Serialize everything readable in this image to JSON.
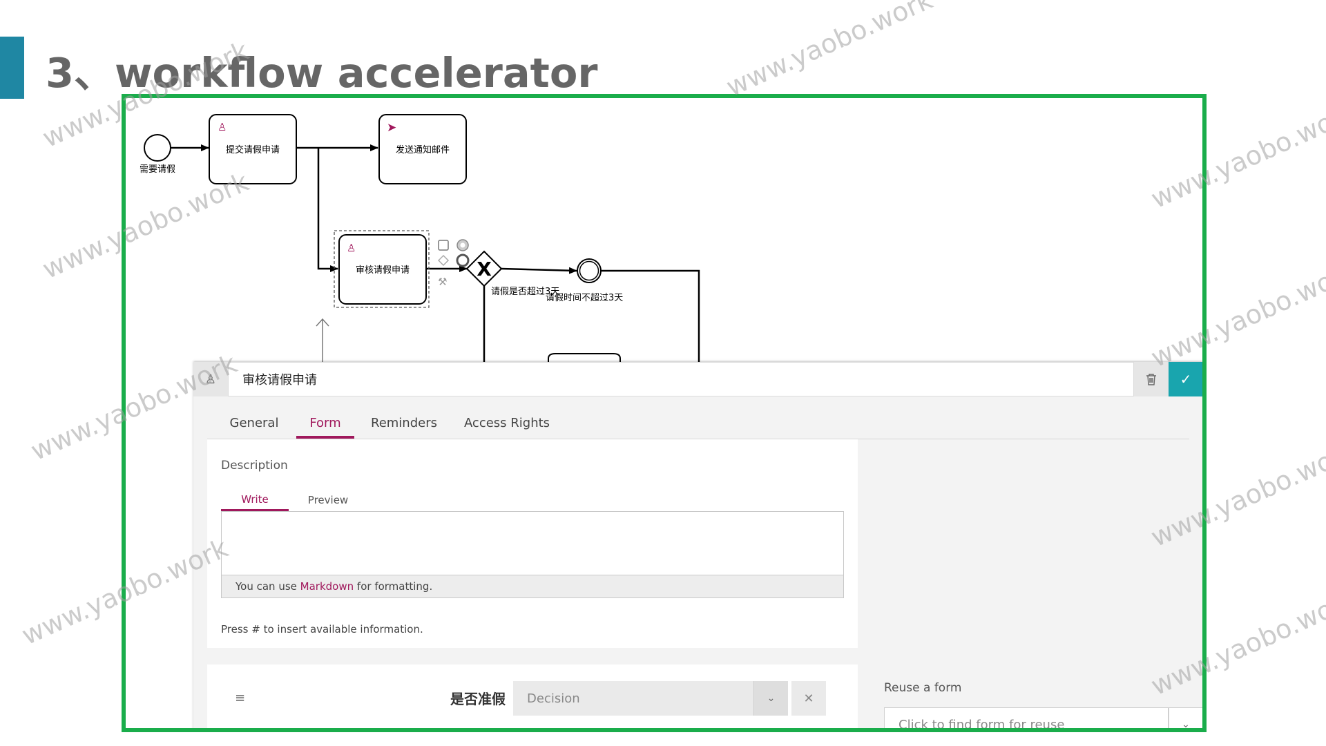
{
  "slide": {
    "title": "3、workflow accelerator",
    "watermark": "www.yaobo.work"
  },
  "diagram": {
    "start_event_label": "需要请假",
    "task_submit": "提交请假申请",
    "task_email": "发送通知邮件",
    "task_review": "审核请假申请",
    "gateway_label": "请假是否超过3天",
    "flow_label": "请假时间不超过3天"
  },
  "panel": {
    "element_name": "审核请假申请",
    "tabs": [
      {
        "label": "General"
      },
      {
        "label": "Form"
      },
      {
        "label": "Reminders"
      },
      {
        "label": "Access Rights"
      }
    ],
    "active_tab": "Form",
    "description": {
      "label": "Description",
      "subtabs": [
        "Write",
        "Preview"
      ],
      "footer_prefix": "You can use ",
      "footer_link": "Markdown",
      "footer_suffix": " for formatting.",
      "hint": "Press # to insert available information."
    },
    "field": {
      "drag_icon": "≡",
      "label": "是否准假",
      "placeholder": "Decision"
    },
    "reuse": {
      "label": "Reuse a form",
      "placeholder": "Click to find form for reuse"
    }
  },
  "colors": {
    "accent_teal": "#19a5ae",
    "accent_magenta": "#a0185c",
    "frame_green": "#1aad4b",
    "title_bar": "#1f87a3"
  }
}
